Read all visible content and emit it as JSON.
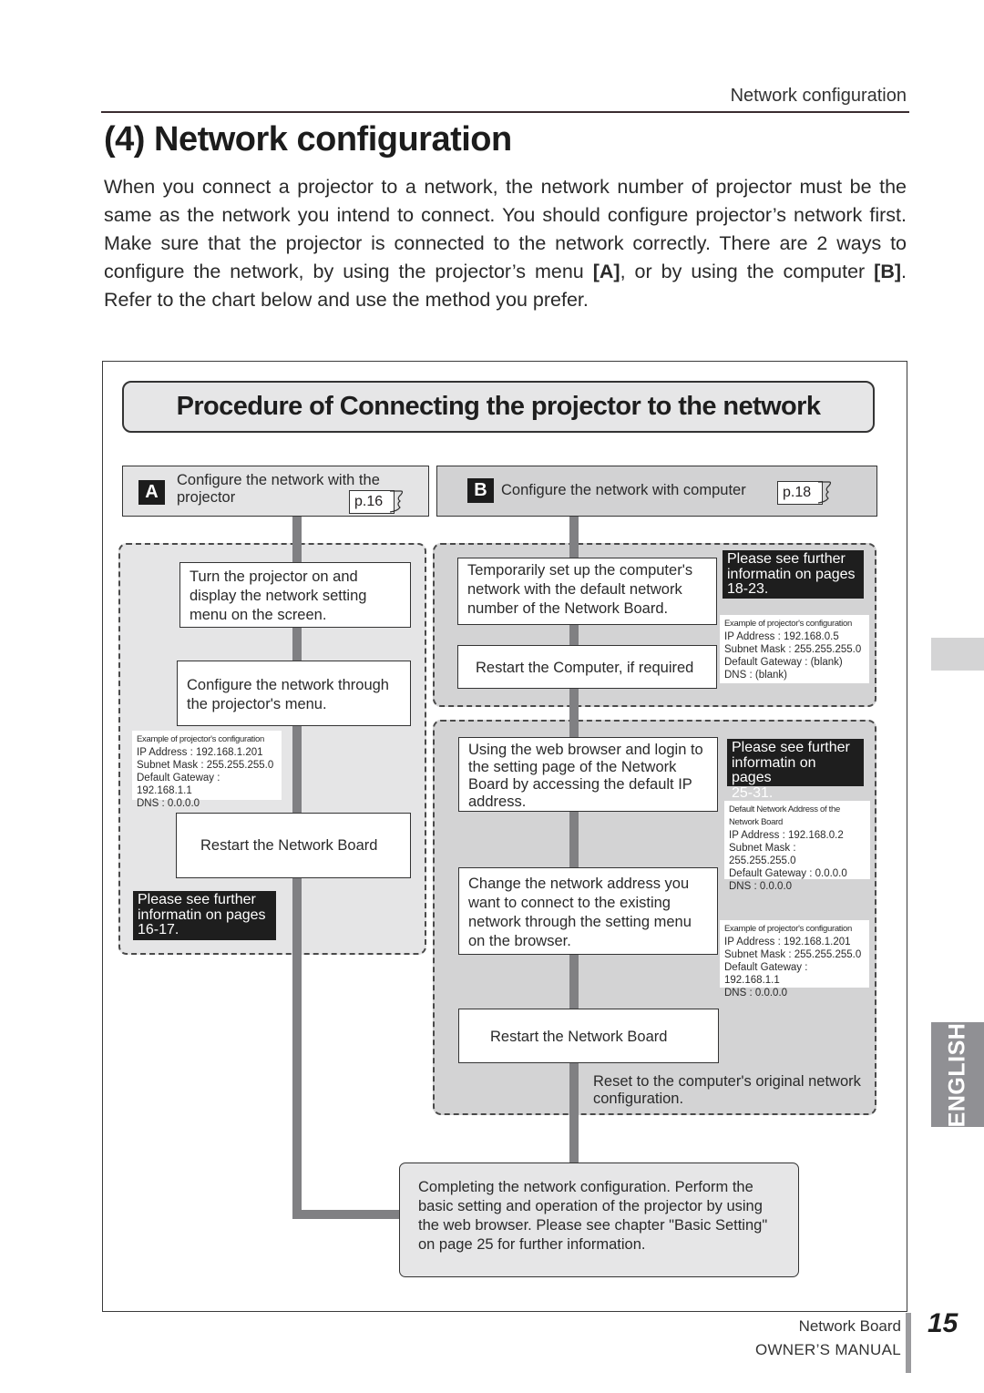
{
  "running_head": "Network configuration",
  "title": "(4) Network configuration",
  "intro": {
    "part1": "When you connect a projector to a network, the network number of projector must be the same as the network you intend to connect. You should configure projector’s network first. Make sure that the projector is connected to the network correctly. There are 2 ways to configure the network, by using the projector’s menu ",
    "ref_a": "[A]",
    "part2": ", or by using the computer ",
    "ref_b": "[B]",
    "part3": ". Refer to the chart below and use the method you prefer."
  },
  "chart": {
    "title": "Procedure of Connecting the projector to the network",
    "method_a": {
      "badge": "A",
      "label_line1": "Configure the network with the",
      "label_line2": "projector",
      "page_ref": "p.16",
      "steps": [
        "Turn the projector on and display the network setting menu on the screen.",
        "Configure the network through the projector's menu.",
        "Restart the Network Board"
      ],
      "config_example": {
        "caption": "Example of projector's configuration",
        "lines": [
          "IP Address : 192.168.1.201",
          "Subnet Mask : 255.255.255.0",
          "Default Gateway : 192.168.1.1",
          "DNS :  0.0.0.0"
        ]
      },
      "note": {
        "line1": "Please see further",
        "line2": "informatin on pages",
        "line3": "16-17."
      }
    },
    "method_b": {
      "badge": "B",
      "label": "Configure the network with computer",
      "page_ref": "p.18",
      "group1": {
        "steps": [
          "Temporarily set up the computer's network with the default network number of the Network Board.",
          "Restart the Computer, if required"
        ],
        "note": {
          "line1": "Please see further",
          "line2": "informatin on pages",
          "line3": "18-23."
        },
        "config_example": {
          "caption": "Example of projector's configuration",
          "lines": [
            "IP Address : 192.168.0.5",
            "Subnet Mask : 255.255.255.0",
            "Default Gateway : (blank)",
            "DNS : (blank)"
          ]
        }
      },
      "group2": {
        "steps": [
          "Using the web browser and login to the setting page of the Network Board by accessing the default IP address.",
          "Change the network address you want to connect to the existing network through the setting menu on the browser.",
          "Restart the Network Board"
        ],
        "note": {
          "line1": "Please see further",
          "line2": "informatin on pages",
          "line3": "25-31."
        },
        "default_address": {
          "caption": "Default Network Address of the Network Board",
          "lines": [
            "IP Address : 192.168.0.2",
            "Subnet Mask : 255.255.255.0",
            "Default Gateway : 0.0.0.0",
            "DNS : 0.0.0.0"
          ]
        },
        "config_example": {
          "caption": "Example of projector's configuration",
          "lines": [
            "IP Address : 192.168.1.201",
            "Subnet Mask : 255.255.255.0",
            "Default Gateway : 192.168.1.1",
            "DNS : 0.0.0.0"
          ]
        },
        "reset_note": "Reset to the computer's original network configuration."
      }
    },
    "final": "Completing the network configuration. Perform the basic setting and operation of the projector by using the web browser. Please see chapter \"Basic Setting\" on page 25 for further information."
  },
  "side_tab": "ENGLISH",
  "footer": {
    "line1": "Network Board",
    "line2": "OWNER’S MANUAL",
    "page_number": "15"
  }
}
